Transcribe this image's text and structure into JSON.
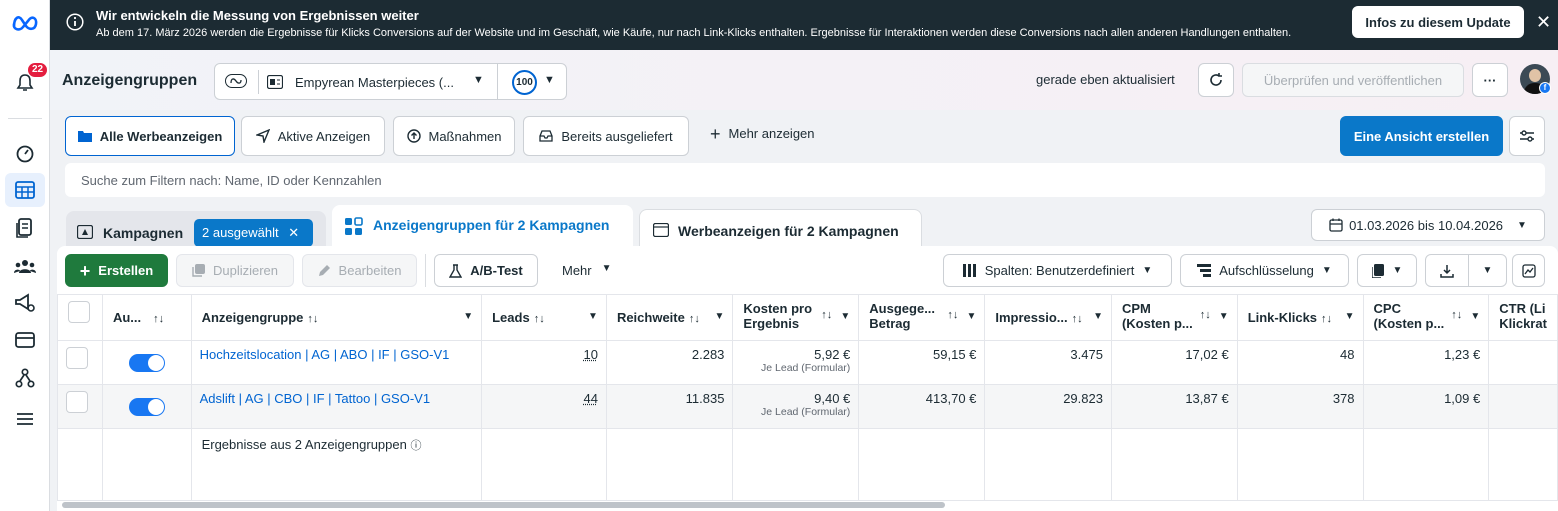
{
  "sidebar": {
    "notification_count": "22",
    "items": [
      "meta-logo",
      "notifications",
      "dashboard",
      "ads-manager",
      "reports",
      "audiences",
      "campaign-tools",
      "billing",
      "business-settings",
      "menu"
    ]
  },
  "banner": {
    "title": "Wir entwickeln die Messung von Ergebnissen weiter",
    "text": "Ab dem 17. März 2026 werden die Ergebnisse für Klicks Conversions auf der Website und im Geschäft, wie Käufe, nur nach Link-Klicks enthalten. Ergebnisse für Interaktionen werden diese Conversions nach allen anderen Handlungen enthalten.",
    "button": "Infos zu diesem Update"
  },
  "header": {
    "title": "Anzeigengruppen",
    "account_name": "Empyrean Masterpieces (...",
    "score": "100",
    "updated": "gerade eben aktualisiert",
    "publish_button": "Überprüfen und veröffentlichen",
    "more": "···"
  },
  "filters": {
    "all_ads": "Alle Werbeanzeigen",
    "active_ads": "Aktive Anzeigen",
    "actions": "Maßnahmen",
    "delivered": "Bereits ausgeliefert",
    "more": "Mehr anzeigen",
    "create_view": "Eine Ansicht erstellen",
    "search_placeholder": "Suche zum Filtern nach: Name, ID oder Kennzahlen"
  },
  "tabs": {
    "campaigns": "Kampagnen",
    "selected": "2 ausgewählt",
    "adsets": "Anzeigengruppen für 2 Kampagnen",
    "ads": "Werbeanzeigen für 2 Kampagnen",
    "date_range": "01.03.2026 bis 10.04.2026"
  },
  "toolbar": {
    "create": "Erstellen",
    "duplicate": "Duplizieren",
    "edit": "Bearbeiten",
    "ab_test": "A/B-Test",
    "more": "Mehr",
    "columns": "Spalten: Benutzerdefiniert",
    "breakdown": "Aufschlüsselung"
  },
  "table": {
    "headers": {
      "status": "Au...",
      "name": "Anzeigengruppe",
      "leads": "Leads",
      "reach": "Reichweite",
      "cost_per_result_1": "Kosten pro",
      "cost_per_result_2": "Ergebnis",
      "spent_1": "Ausgege...",
      "spent_2": "Betrag",
      "impressions": "Impressio...",
      "cpm_1": "CPM",
      "cpm_2": "(Kosten p...",
      "link_clicks": "Link-Klicks",
      "cpc_1": "CPC",
      "cpc_2": "(Kosten p...",
      "ctr_1": "CTR (Li",
      "ctr_2": "Klickrat"
    },
    "rows": [
      {
        "name": "Hochzeitslocation | AG | ABO | IF | GSO-V1",
        "leads": "10",
        "reach": "2.283",
        "cost": "5,92 €",
        "cost_sub": "Je Lead (Formular)",
        "spent": "59,15 €",
        "impressions": "3.475",
        "cpm": "17,02 €",
        "clicks": "48",
        "cpc": "1,23 €"
      },
      {
        "name": "Adslift | AG | CBO | IF | Tattoo | GSO-V1",
        "leads": "44",
        "reach": "11.835",
        "cost": "9,40 €",
        "cost_sub": "Je Lead (Formular)",
        "spent": "413,70 €",
        "impressions": "29.823",
        "cpm": "13,87 €",
        "clicks": "378",
        "cpc": "1,09 €"
      }
    ],
    "summary": "Ergebnisse aus 2 Anzeigengruppen"
  }
}
